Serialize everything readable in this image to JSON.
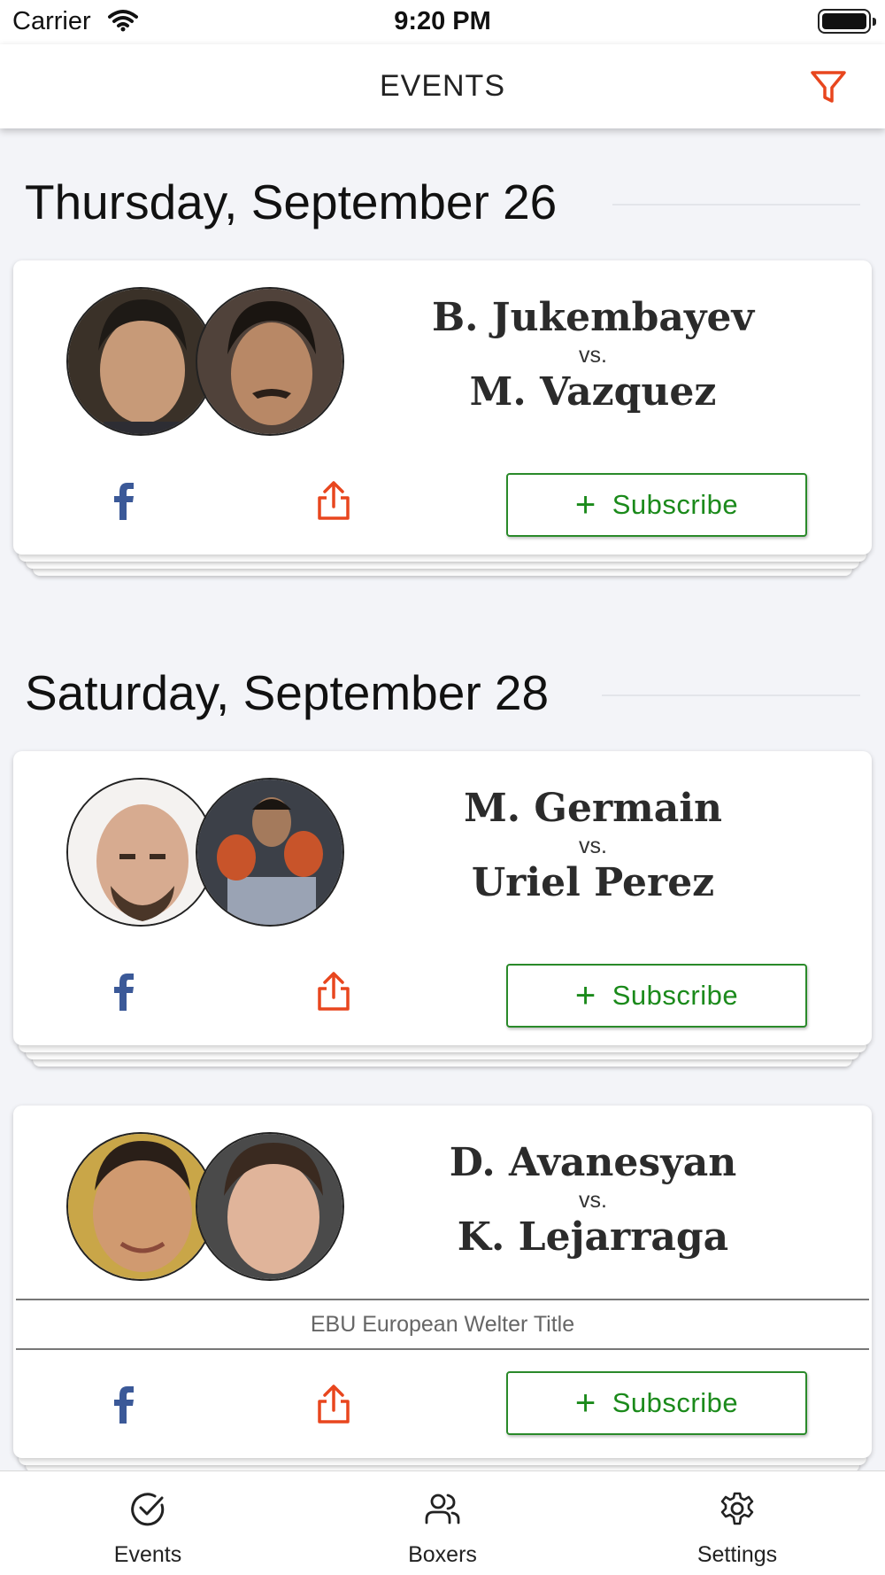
{
  "status_bar": {
    "carrier": "Carrier",
    "time": "9:20 PM"
  },
  "nav": {
    "title": "EVENTS",
    "filter_icon": "filter-icon",
    "accent": "#e8461e"
  },
  "sections": [
    {
      "date": "Thursday, September 26",
      "events": [
        {
          "fighter_a": "B. Jukembayev",
          "vs": "vs.",
          "fighter_b": "M. Vazquez",
          "title": "",
          "subscribe_label": "Subscribe"
        }
      ]
    },
    {
      "date": "Saturday, September 28",
      "events": [
        {
          "fighter_a": "M. Germain",
          "vs": "vs.",
          "fighter_b": "Uriel Perez",
          "title": "",
          "subscribe_label": "Subscribe"
        },
        {
          "fighter_a": "D. Avanesyan",
          "vs": "vs.",
          "fighter_b": "K. Lejarraga",
          "title": "EBU European Welter Title",
          "subscribe_label": "Subscribe"
        }
      ]
    }
  ],
  "tabs": [
    {
      "label": "Events",
      "icon": "check-circle-icon"
    },
    {
      "label": "Boxers",
      "icon": "users-icon"
    },
    {
      "label": "Settings",
      "icon": "gear-icon"
    }
  ],
  "colors": {
    "facebook": "#3b5998",
    "share": "#e8461e",
    "subscribe": "#1b8a1b",
    "background": "#f3f4f8"
  }
}
